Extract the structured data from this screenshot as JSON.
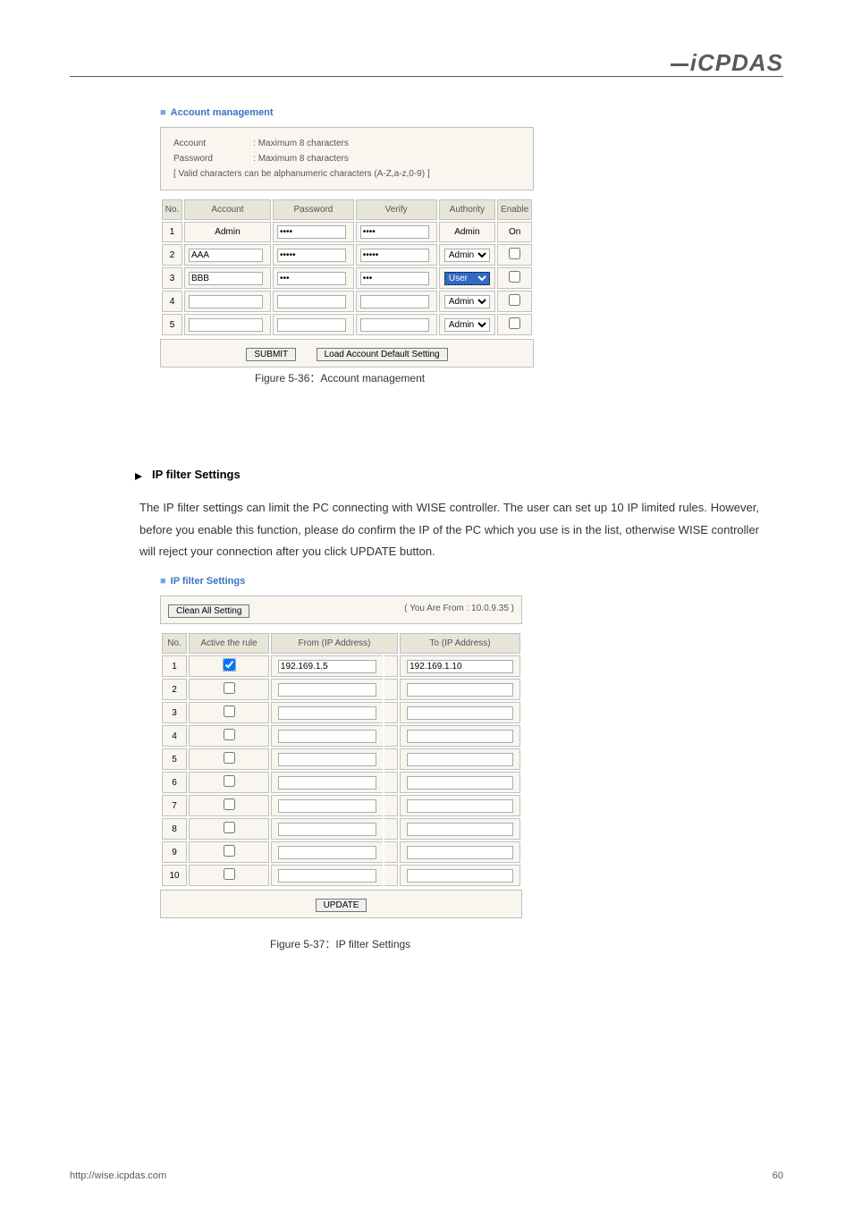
{
  "header": {
    "logo_text": "iCPDAS"
  },
  "account_panel": {
    "title": "Account management",
    "info": {
      "account_line": ": Maximum 8 characters",
      "password_line": ": Maximum 8 characters",
      "valid_line": "[ Valid characters can be alphanumeric characters (A-Z,a-z,0-9) ]",
      "account_label": "Account",
      "password_label": "Password"
    },
    "headers": {
      "no": "No.",
      "account": "Account",
      "password": "Password",
      "verify": "Verify",
      "authority": "Authority",
      "enable": "Enable"
    },
    "rows": [
      {
        "no": "1",
        "account": "Admin",
        "password": "●●●●",
        "verify": "●●●●",
        "authority_text": "Admin",
        "authority_select": null,
        "enable_text": "On",
        "enable_checkbox": null,
        "static": true
      },
      {
        "no": "2",
        "account": "AAA",
        "password": "●●●●●",
        "verify": "●●●●●",
        "authority_select": "Admin",
        "enable_checkbox": false,
        "static": false
      },
      {
        "no": "3",
        "account": "BBB",
        "password": "●●●",
        "verify": "●●●",
        "authority_select": "User",
        "highlighted": true,
        "enable_checkbox": false,
        "static": false
      },
      {
        "no": "4",
        "account": "",
        "password": "",
        "verify": "",
        "authority_select": "Admin",
        "enable_checkbox": false,
        "static": false
      },
      {
        "no": "5",
        "account": "",
        "password": "",
        "verify": "",
        "authority_select": "Admin",
        "enable_checkbox": false,
        "static": false
      }
    ],
    "buttons": {
      "submit": "SUBMIT",
      "load_default": "Load Account Default Setting"
    }
  },
  "figure_captions": {
    "fig1": "Figure 5-36：Account management",
    "fig2": "Figure 5-37：IP filter Settings"
  },
  "ip_section": {
    "heading": "IP filter Settings",
    "body_text": "The IP filter settings can limit the PC connecting with WISE controller. The user can set up 10 IP limited rules. However, before you enable this function, please do confirm the IP of the PC which you use is in the list, otherwise WISE controller will reject your connection after you click UPDATE button."
  },
  "ip_panel": {
    "title": "IP filter Settings",
    "clean_button": "Clean All Setting",
    "you_from": "( You Are From : 10.0.9.35 )",
    "headers": {
      "no": "No.",
      "active": "Active the rule",
      "from": "From (IP Address)",
      "to": "To (IP Address)"
    },
    "rows": [
      {
        "no": "1",
        "active": true,
        "dashed": true,
        "from": "192.169.1.5",
        "to": "192.169.1.10"
      },
      {
        "no": "2",
        "active": false,
        "from": "",
        "to": ""
      },
      {
        "no": "3",
        "active": false,
        "from": "",
        "to": ""
      },
      {
        "no": "4",
        "active": false,
        "from": "",
        "to": ""
      },
      {
        "no": "5",
        "active": false,
        "from": "",
        "to": ""
      },
      {
        "no": "6",
        "active": false,
        "from": "",
        "to": ""
      },
      {
        "no": "7",
        "active": false,
        "from": "",
        "to": ""
      },
      {
        "no": "8",
        "active": false,
        "from": "",
        "to": ""
      },
      {
        "no": "9",
        "active": false,
        "from": "",
        "to": ""
      },
      {
        "no": "10",
        "active": false,
        "from": "",
        "to": ""
      }
    ],
    "update_button": "UPDATE"
  },
  "footer": {
    "left": "http://wise.icpdas.com",
    "right": "60"
  },
  "select_options": {
    "authority": [
      "Admin",
      "User"
    ]
  }
}
